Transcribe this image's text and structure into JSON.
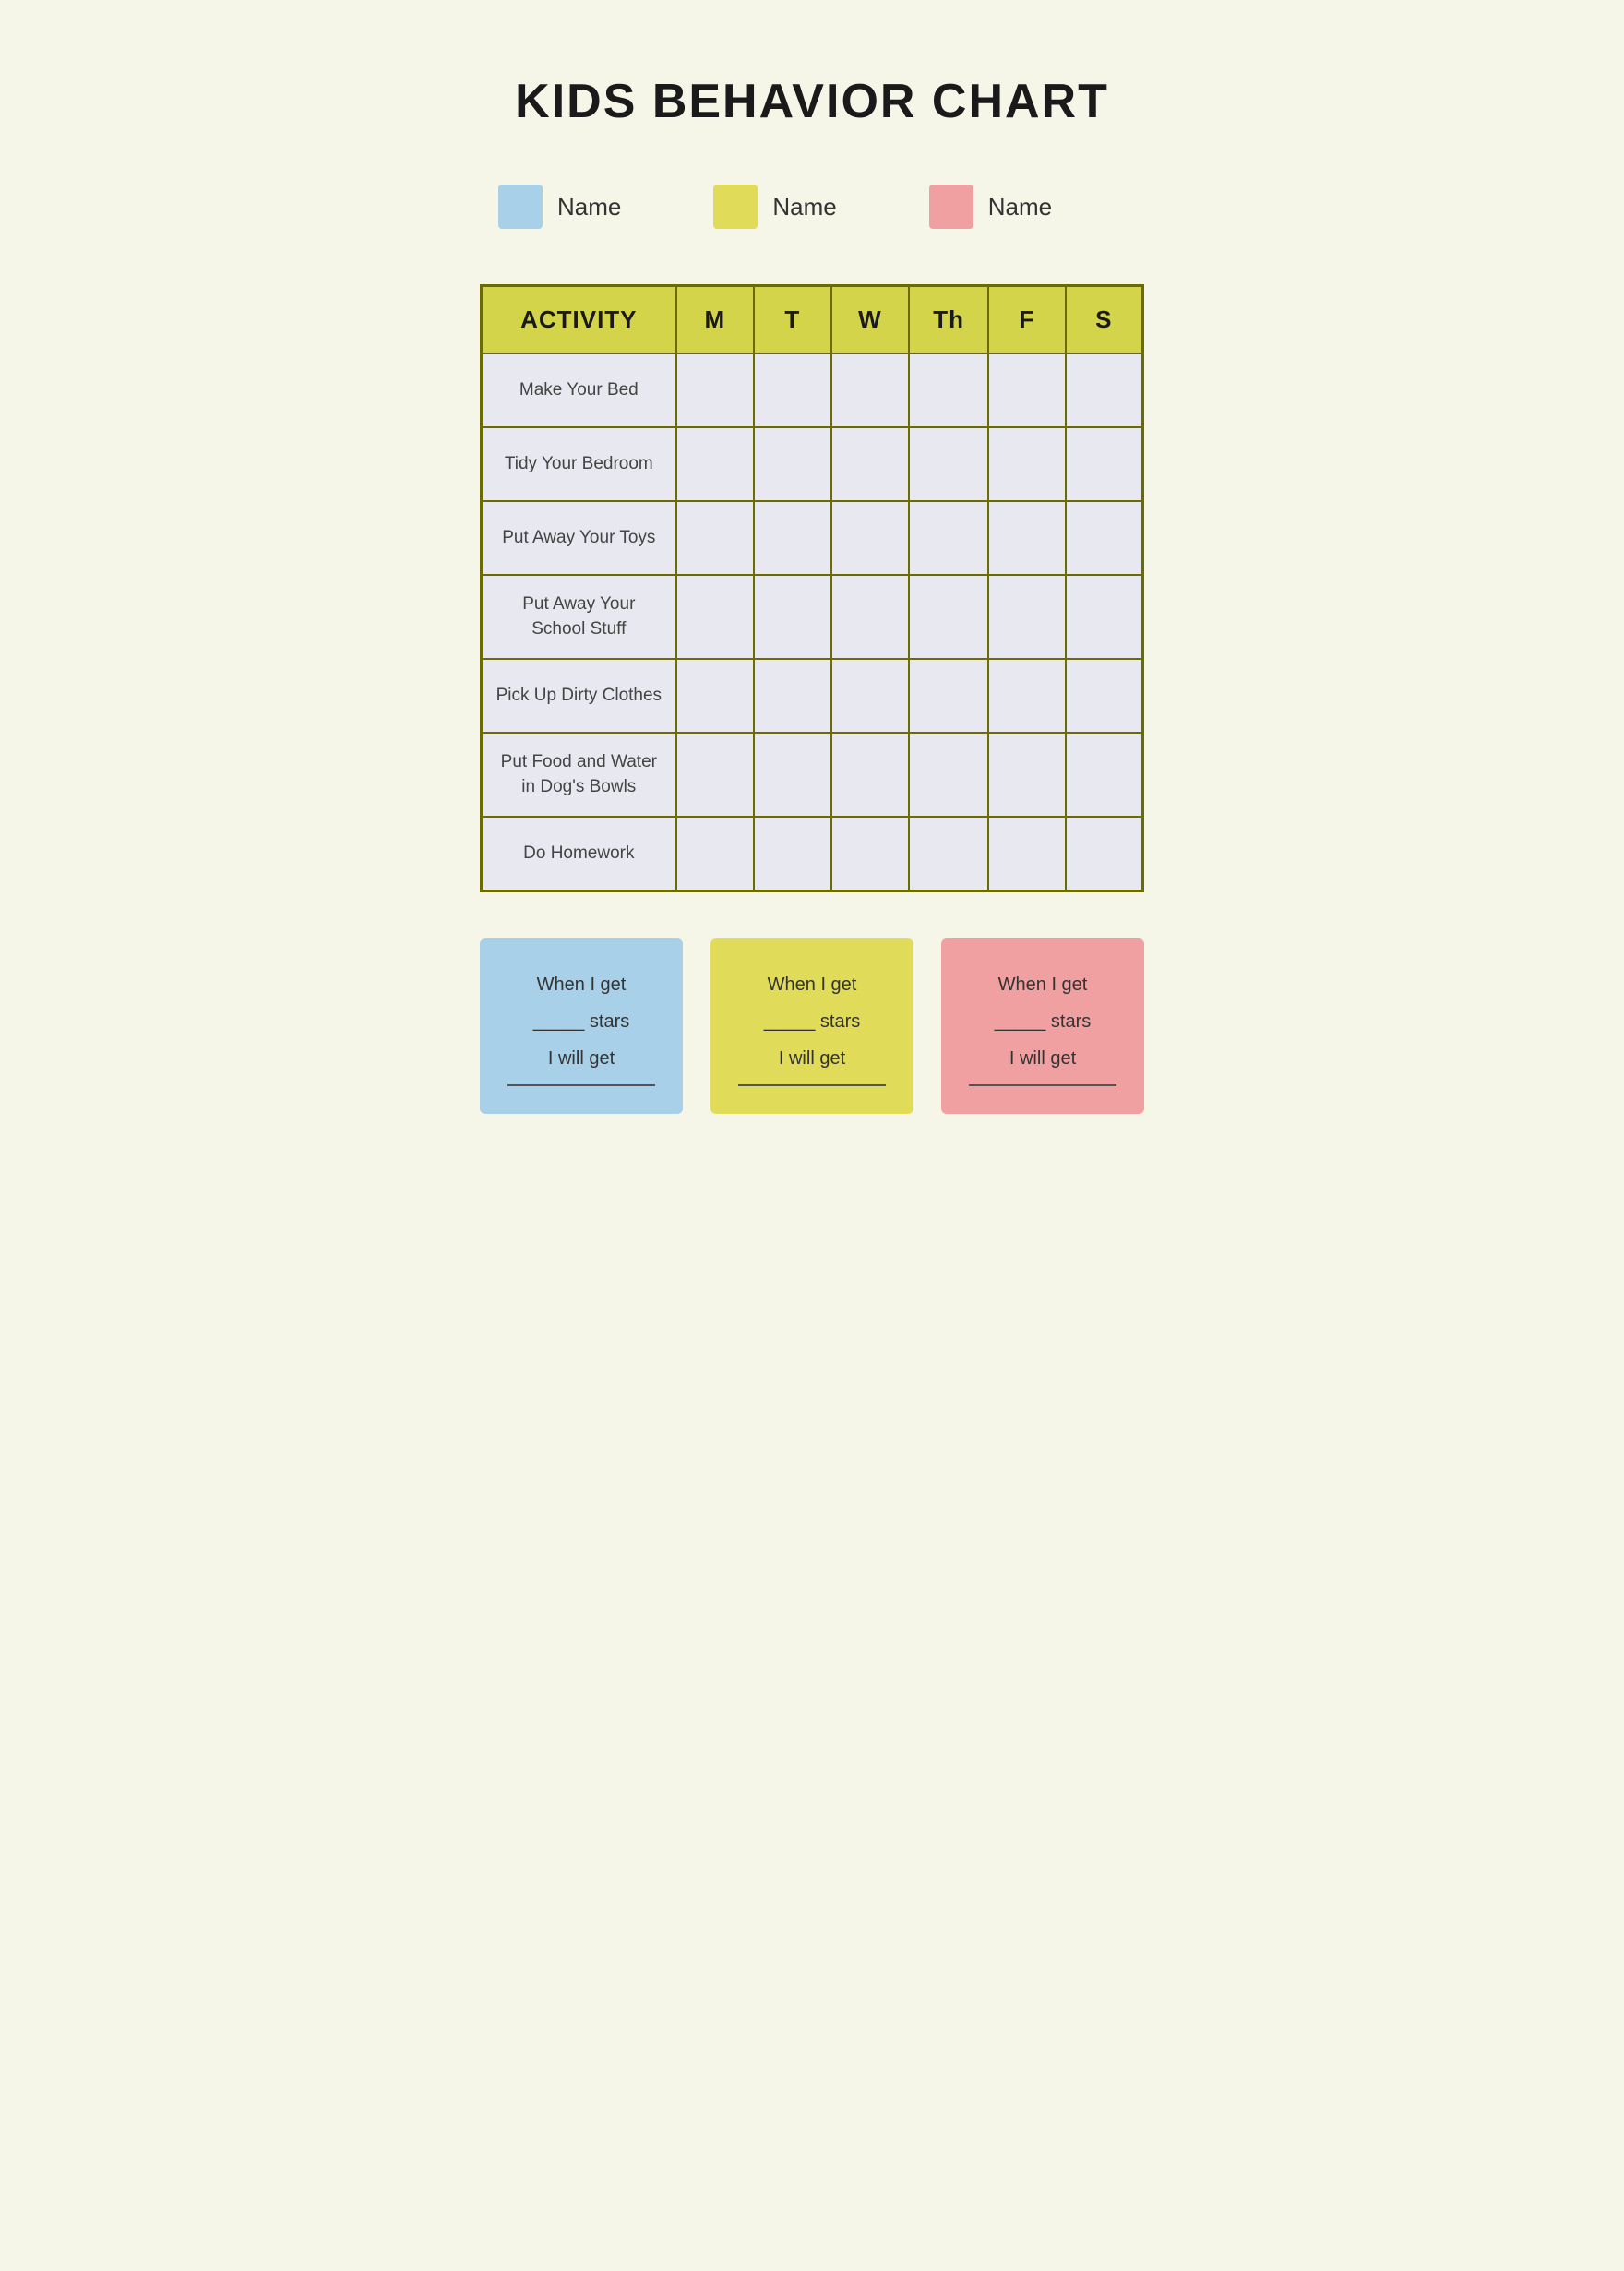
{
  "page": {
    "background_color": "#f5f5e8",
    "title": "KIDS BEHAVIOR CHART"
  },
  "legend": {
    "items": [
      {
        "color": "#a8d0e8",
        "label": "Name"
      },
      {
        "color": "#e0dc5a",
        "label": "Name"
      },
      {
        "color": "#f0a0a0",
        "label": "Name"
      }
    ]
  },
  "table": {
    "header": {
      "activity_label": "ACTIVITY",
      "days": [
        "M",
        "T",
        "W",
        "Th",
        "F",
        "S"
      ]
    },
    "rows": [
      {
        "activity": "Make Your Bed"
      },
      {
        "activity": "Tidy Your Bedroom"
      },
      {
        "activity": "Put Away Your Toys"
      },
      {
        "activity": "Put Away Your School Stuff"
      },
      {
        "activity": "Pick Up Dirty Clothes"
      },
      {
        "activity": "Put Food and Water in Dog's Bowls"
      },
      {
        "activity": "Do Homework"
      }
    ]
  },
  "reward_cards": [
    {
      "color": "#a8d0e8",
      "line1": "When I get",
      "line2": "_____ stars",
      "line3": "I will get"
    },
    {
      "color": "#e0dc5a",
      "line1": "When I get",
      "line2": "_____ stars",
      "line3": "I will get"
    },
    {
      "color": "#f0a0a0",
      "line1": "When I get",
      "line2": "_____ stars",
      "line3": "I will get"
    }
  ]
}
